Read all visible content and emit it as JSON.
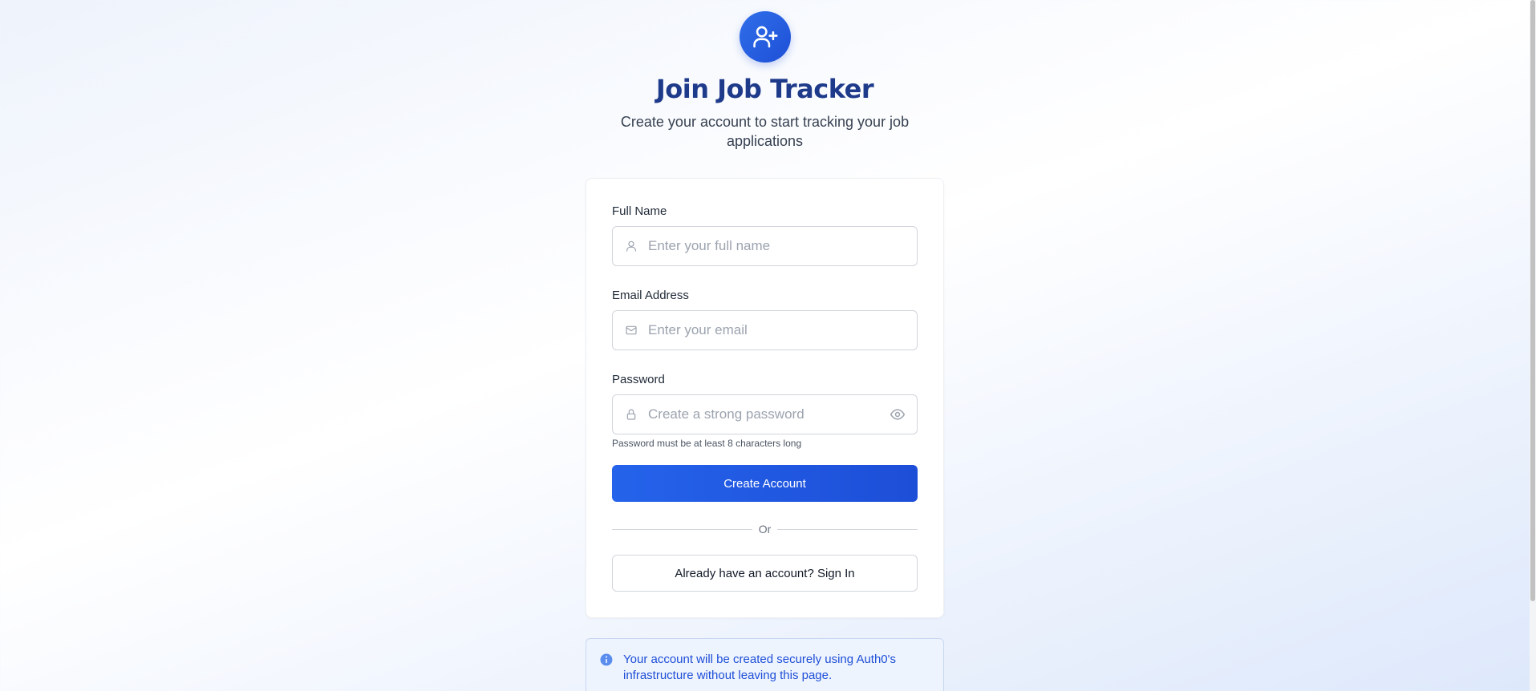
{
  "header": {
    "logo_icon": "user-plus-icon",
    "title": "Join Job Tracker",
    "subtitle": "Create your account to start tracking your job applications"
  },
  "form": {
    "full_name": {
      "label": "Full Name",
      "placeholder": "Enter your full name",
      "icon": "user-icon"
    },
    "email": {
      "label": "Email Address",
      "placeholder": "Enter your email",
      "icon": "mail-icon"
    },
    "password": {
      "label": "Password",
      "placeholder": "Create a strong password",
      "icon": "lock-icon",
      "toggle_icon": "eye-icon",
      "hint": "Password must be at least 8 characters long"
    },
    "submit_label": "Create Account",
    "divider_text": "Or",
    "signin_label": "Already have an account? Sign In"
  },
  "info": {
    "icon": "info-icon",
    "text": "Your account will be created securely using Auth0's infrastructure without leaving this page."
  },
  "colors": {
    "accent": "#2563eb",
    "title": "#1e3a8a",
    "info_text": "#1d4ed8"
  }
}
